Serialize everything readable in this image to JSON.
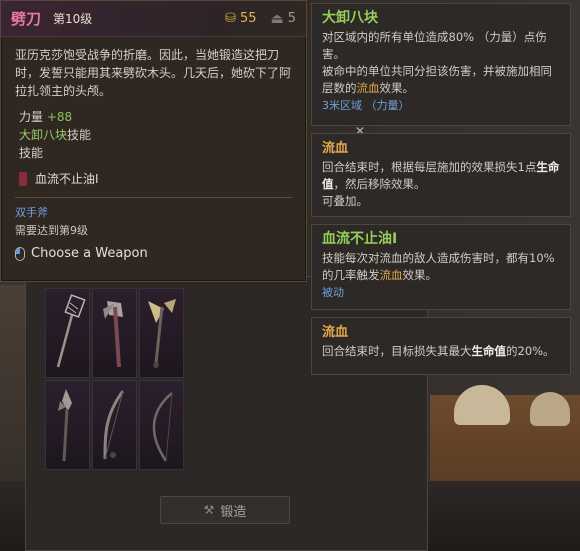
{
  "item": {
    "name": "劈刀",
    "level": "第10级",
    "price": "55",
    "weight": "5",
    "description": "亚历克莎饱受战争的折磨。因此，当她锻造这把刀时，发誓只能用其来劈砍木头。几天后，她砍下了阿拉扎领主的头颅。",
    "stat_label": "力量",
    "stat_value": "+88",
    "skill_name": "大卸八块",
    "skill_suffix": "技能",
    "skill_label": "技能",
    "rune": "血流不止油I",
    "type": "双手斧",
    "requirement": "需要达到第9级",
    "choose_label": "Choose a Weapon"
  },
  "tips": {
    "dismember": {
      "title": "大卸八块",
      "line1": "对区域内的所有单位造成80% （力量）点伤害。",
      "line2_a": "被命中的单位共同分担该伤害，并被施加相同层数的",
      "line2_hl": "流血",
      "line2_b": "效果。",
      "area": "3米区域 （力量）"
    },
    "bleed1": {
      "title": "流血",
      "text_a": "回合结束时，根据每层施加的效果损失1点",
      "text_hl": "生命值",
      "text_b": "，然后移除效果。",
      "text_c": "可叠加。"
    },
    "bleed_oil": {
      "title": "血流不止油I",
      "text_a": "技能每次对流血的敌人造成伤害时，都有10%的几率触发",
      "text_hl": "流血",
      "text_b": "效果。",
      "passive": "被动"
    },
    "bleed2": {
      "title": "流血",
      "text_a": "回合结束时，目标损失其最大",
      "text_hl": "生命值",
      "text_b": "的20%。"
    }
  },
  "forge": {
    "label": "锻造"
  },
  "weapons": [
    "fly-swatter",
    "double-axe",
    "halberd",
    "spear",
    "recurve-bow",
    "longbow"
  ],
  "icons": {
    "coin": "coin-icon",
    "weight": "weight-icon",
    "mouse": "mouse-icon",
    "hammer": "hammer-icon"
  }
}
